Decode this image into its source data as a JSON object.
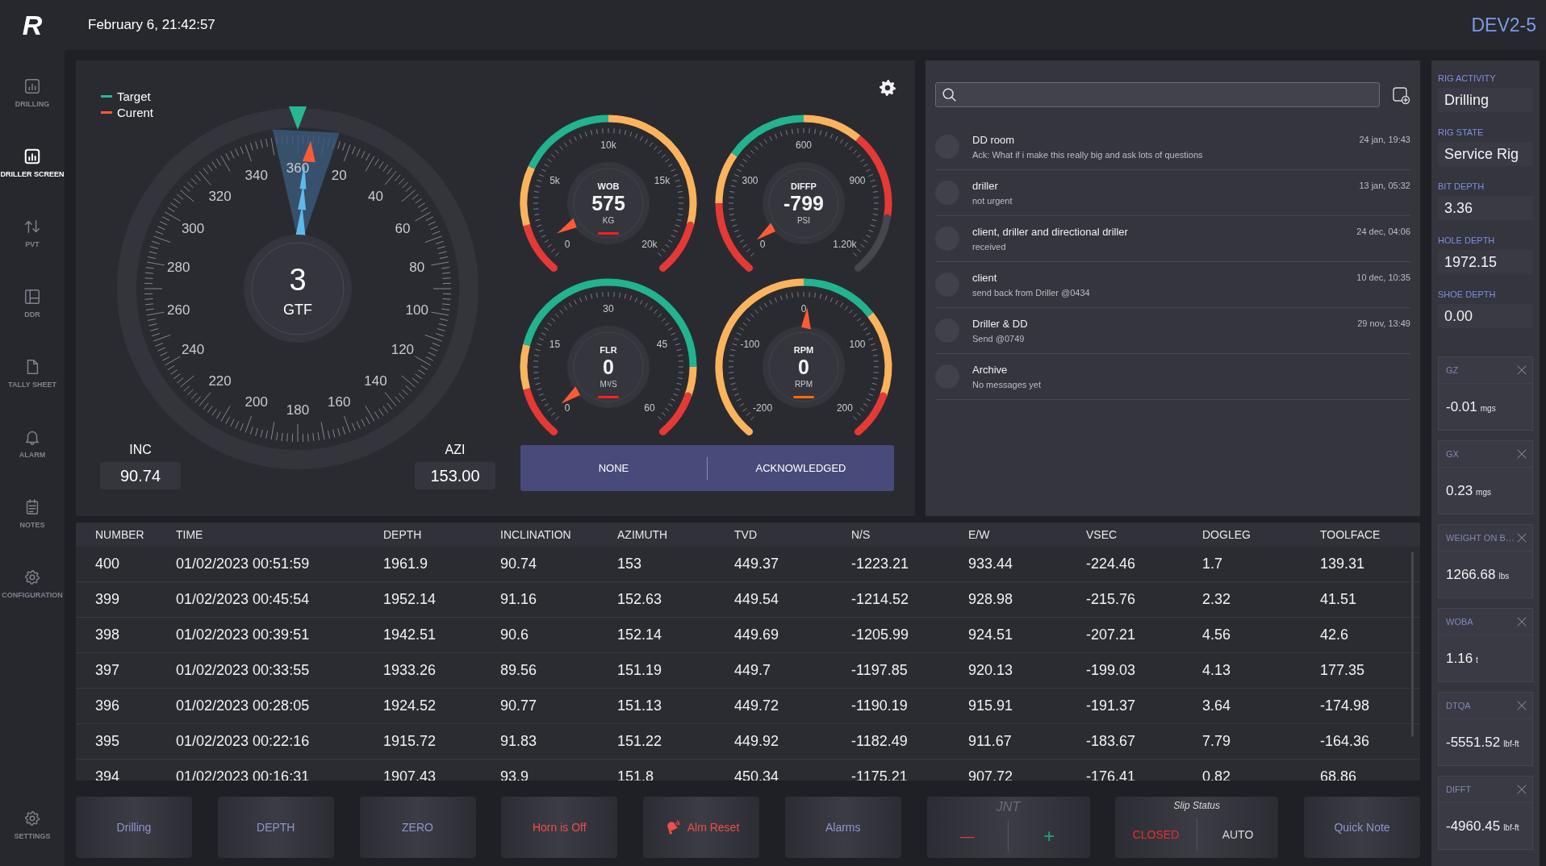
{
  "header": {
    "logo": "R",
    "datetime": "February 6, 21:42:57",
    "rig_name": "DEV2-5"
  },
  "sidebar": {
    "items": [
      {
        "label": "DRILLING",
        "selected": false
      },
      {
        "label": "DRILLER SCREEN",
        "selected": true
      },
      {
        "label": "PVT",
        "selected": false
      },
      {
        "label": "DDR",
        "selected": false
      },
      {
        "label": "TALLY SHEET",
        "selected": false
      },
      {
        "label": "ALARM",
        "selected": false
      },
      {
        "label": "NOTES",
        "selected": false
      },
      {
        "label": "CONFIGURATION",
        "selected": false
      }
    ],
    "settings": {
      "label": "SETTINGS"
    }
  },
  "compass": {
    "legend": [
      {
        "label": "Target",
        "color": "#26b893"
      },
      {
        "label": "Curent",
        "color": "#ff5a36"
      }
    ],
    "dial_labels": [
      "360",
      "20",
      "40",
      "60",
      "80",
      "100",
      "120",
      "140",
      "160",
      "180",
      "200",
      "220",
      "240",
      "260",
      "280",
      "300",
      "320",
      "340"
    ],
    "value": "3",
    "label": "GTF",
    "inc": {
      "label": "INC",
      "value": "90.74"
    },
    "azi": {
      "label": "AZI",
      "value": "153.00"
    }
  },
  "gauges": [
    {
      "label": "WOB",
      "value": "575",
      "unit": "KG",
      "scale": [
        "0",
        "5k",
        "10k",
        "15k",
        "20k"
      ],
      "color": "#ff2020"
    },
    {
      "label": "DIFFP",
      "value": "-799",
      "unit": "PSI",
      "scale": [
        "0",
        "300",
        "600",
        "900",
        "1.20k"
      ]
    },
    {
      "label": "FLR",
      "value": "0",
      "unit": "M³/S",
      "scale": [
        "0",
        "15",
        "30",
        "45",
        "60"
      ],
      "color": "#ff2020"
    },
    {
      "label": "RPM",
      "value": "0",
      "unit": "RPM",
      "scale": [
        "-200",
        "-100",
        "0",
        "100",
        "200"
      ],
      "color": "#ff6a00"
    }
  ],
  "alarm_toggle": {
    "options": [
      "NONE",
      "ACKNOWLEDGED"
    ]
  },
  "messages": {
    "conversations": [
      {
        "name": "DD room",
        "preview": "Ack: What if i make this really big and ask lots of questions",
        "time": "24 jan, 19:43"
      },
      {
        "name": "driller",
        "preview": "not urgent",
        "time": "13 jan, 05:32"
      },
      {
        "name": "client, driller and directional driller",
        "preview": "received",
        "time": "24 dec, 04:06"
      },
      {
        "name": "client",
        "preview": "send back from Driller @0434",
        "time": "10 dec, 10:35"
      },
      {
        "name": "Driller & DD",
        "preview": "Send @0749",
        "time": "29 nov, 13:49"
      },
      {
        "name": "Archive",
        "preview": "No messages yet"
      }
    ]
  },
  "table": {
    "columns": [
      "NUMBER",
      "TIME",
      "DEPTH",
      "INCLINATION",
      "AZIMUTH",
      "TVD",
      "N/S",
      "E/W",
      "VSEC",
      "DOGLEG",
      "TOOLFACE"
    ],
    "rows": [
      [
        "400",
        "01/02/2023 00:51:59",
        "1961.9",
        "90.74",
        "153",
        "449.37",
        "-1223.21",
        "933.44",
        "-224.46",
        "1.7",
        "139.31"
      ],
      [
        "399",
        "01/02/2023 00:45:54",
        "1952.14",
        "91.16",
        "152.63",
        "449.54",
        "-1214.52",
        "928.98",
        "-215.76",
        "2.32",
        "41.51"
      ],
      [
        "398",
        "01/02/2023 00:39:51",
        "1942.51",
        "90.6",
        "152.14",
        "449.69",
        "-1205.99",
        "924.51",
        "-207.21",
        "4.56",
        "42.6"
      ],
      [
        "397",
        "01/02/2023 00:33:55",
        "1933.26",
        "89.56",
        "151.19",
        "449.7",
        "-1197.85",
        "920.13",
        "-199.03",
        "4.13",
        "177.35"
      ],
      [
        "396",
        "01/02/2023 00:28:05",
        "1924.52",
        "90.77",
        "151.13",
        "449.72",
        "-1190.19",
        "915.91",
        "-191.37",
        "3.64",
        "-174.98"
      ],
      [
        "395",
        "01/02/2023 00:22:16",
        "1915.72",
        "91.83",
        "151.22",
        "449.92",
        "-1182.49",
        "911.67",
        "-183.67",
        "7.79",
        "-164.36"
      ],
      [
        "394",
        "01/02/2023 00:16:31",
        "1907.43",
        "93.9",
        "151.8",
        "450.34",
        "-1175.21",
        "907.72",
        "-176.41",
        "0.82",
        "68.86"
      ]
    ]
  },
  "bottom_bar": [
    {
      "kind": "button",
      "label": "Drilling",
      "color": "#8e96cc"
    },
    {
      "kind": "button",
      "label": "DEPTH",
      "color": "#8e96cc"
    },
    {
      "kind": "button",
      "label": "ZERO",
      "color": "#8e96cc"
    },
    {
      "kind": "button",
      "label": "Horn is Off",
      "color": "#ee4d4d"
    },
    {
      "kind": "bell-button",
      "label": "Alm Reset",
      "color": "#ee4d4d"
    },
    {
      "kind": "button",
      "label": "Alarms",
      "color": "#8e96cc"
    },
    {
      "kind": "stepper",
      "title": "JNT",
      "minus": "—",
      "plus": "+"
    },
    {
      "kind": "switch",
      "title": "Slip Status",
      "options": [
        {
          "label": "CLOSED",
          "selected": true
        },
        {
          "label": "AUTO",
          "selected": false
        }
      ]
    },
    {
      "kind": "button",
      "label": "Quick Note",
      "color": "#8e96cc"
    }
  ],
  "right_panel": {
    "fields": [
      {
        "label": "RIG ACTIVITY",
        "value": "Drilling"
      },
      {
        "label": "RIG STATE",
        "value": "Service Rig"
      },
      {
        "label": "BIT DEPTH",
        "value": "3.36"
      },
      {
        "label": "HOLE DEPTH",
        "value": "1972.15"
      },
      {
        "label": "SHOE DEPTH",
        "value": "0.00"
      }
    ],
    "cards": [
      {
        "label": "GZ",
        "value": "-0.01",
        "unit": "mgs"
      },
      {
        "label": "GX",
        "value": "0.23",
        "unit": "mgs"
      },
      {
        "label": "WEIGHT ON B…",
        "value": "1266.68",
        "unit": "lbs"
      },
      {
        "label": "WOBA",
        "value": "1.16",
        "unit": "t"
      },
      {
        "label": "DTQA",
        "value": "-5551.52",
        "unit": "lbf-ft"
      },
      {
        "label": "DIFFT",
        "value": "-4960.45",
        "unit": "lbf-ft"
      }
    ]
  }
}
